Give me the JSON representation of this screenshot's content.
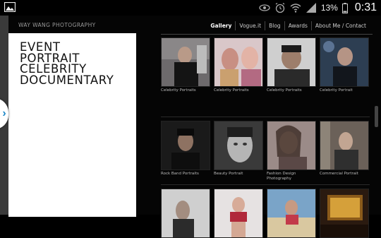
{
  "status_bar": {
    "battery_percent": "13%",
    "time": "0:31"
  },
  "site": {
    "title": "WAY WANG PHOTOGRAPHY"
  },
  "nav": [
    {
      "label": "Gallery",
      "active": true
    },
    {
      "label": "Vogue.it",
      "active": false
    },
    {
      "label": "Blog",
      "active": false
    },
    {
      "label": "Awards",
      "active": false
    },
    {
      "label": "About Me / Contact",
      "active": false
    }
  ],
  "panel": {
    "categories": [
      "EVENT",
      "PORTRAIT",
      "CELEBRITY",
      "DOCUMENTARY"
    ]
  },
  "gallery": {
    "rows": [
      [
        {
          "caption": "Celebrity Portraits"
        },
        {
          "caption": "Celebrity Portraits"
        },
        {
          "caption": "Celebrity Portraits"
        },
        {
          "caption": "Celebrity Portrait"
        }
      ],
      [
        {
          "caption": "Rock Band Portraits"
        },
        {
          "caption": "Beauty Portrait"
        },
        {
          "caption": "Fashion Design Photography"
        },
        {
          "caption": "Commercial Portrait"
        }
      ],
      [
        {
          "caption": ""
        },
        {
          "caption": ""
        },
        {
          "caption": ""
        },
        {
          "caption": ""
        }
      ]
    ]
  }
}
